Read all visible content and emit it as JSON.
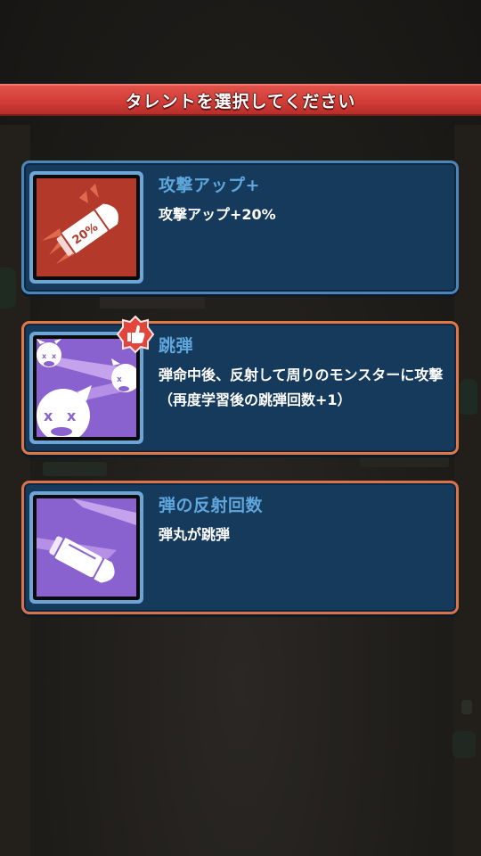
{
  "header": {
    "title": "タレントを選択してください"
  },
  "talents": [
    {
      "name": "攻撃アップ+",
      "description": "攻撃アップ+20%",
      "icon": "bullet-20-percent-icon",
      "icon_label": "20%",
      "icon_bg": "#b33a2b",
      "border_color": "#4b86b6"
    },
    {
      "name": "跳弾",
      "description": "弾命中後、反射して周りのモンスターに攻撃（再度学習後の跳弾回数+1）",
      "icon": "ricochet-monsters-icon",
      "icon_bg": "#8a62d0",
      "border_color": "#e07846",
      "recommended_badge": "thumbs-up-icon"
    },
    {
      "name": "弾の反射回数",
      "description": "弾丸が跳弾",
      "icon": "bouncing-bullet-icon",
      "icon_bg": "#8a62d0",
      "border_color": "#d9744a"
    }
  ],
  "colors": {
    "banner": "#d23e37",
    "card_bg": "#163a5c",
    "talent_name": "#5fa6dc"
  }
}
